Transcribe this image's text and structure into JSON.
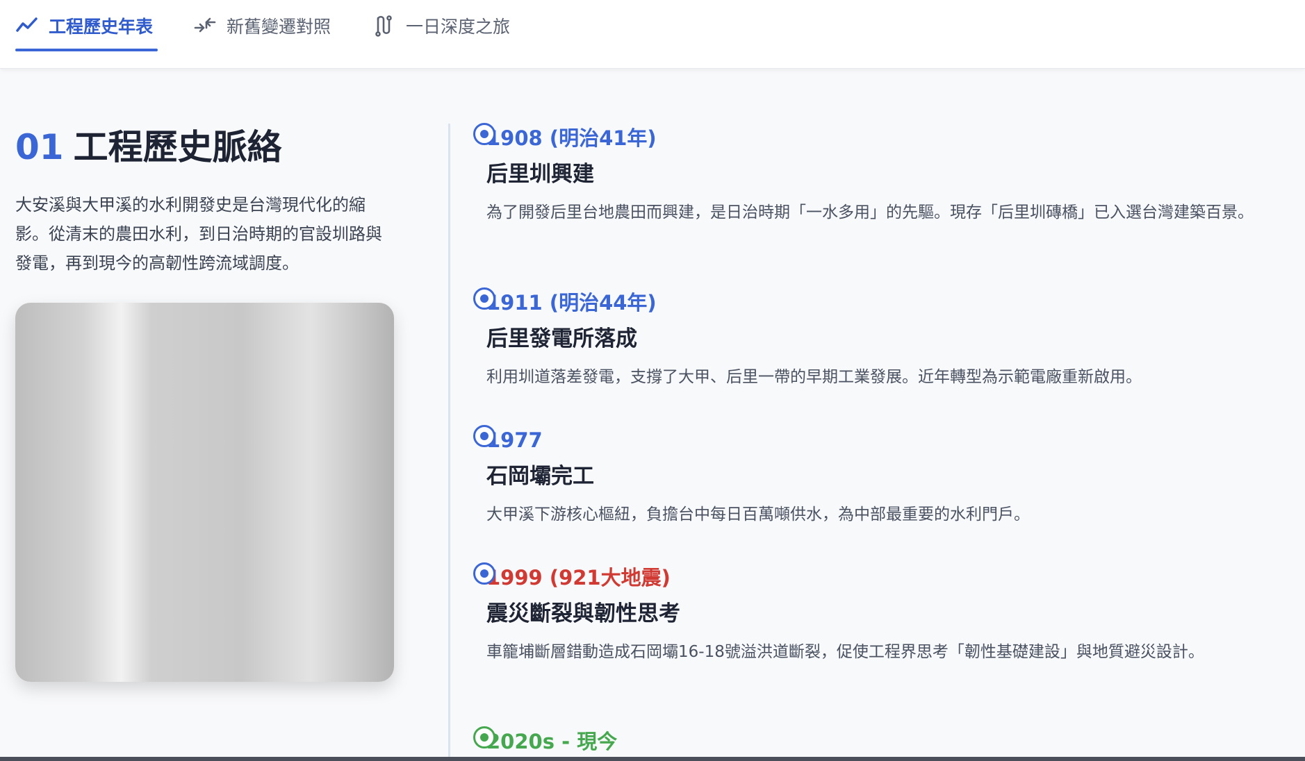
{
  "tabs": [
    {
      "label": "工程歷史年表",
      "icon": "trend-line-icon",
      "active": true
    },
    {
      "label": "新舊變遷對照",
      "icon": "compare-arrows-icon",
      "active": false
    },
    {
      "label": "一日深度之旅",
      "icon": "route-icon",
      "active": false
    }
  ],
  "section": {
    "number": "01",
    "title": "工程歷史脈絡",
    "intro": "大安溪與大甲溪的水利開發史是台灣現代化的縮影。從清末的農田水利，到日治時期的官設圳路與發電，再到現今的高韌性跨流域調度。"
  },
  "timeline": [
    {
      "year": "1908 (明治41年)",
      "title": "后里圳興建",
      "desc": "為了開發后里台地農田而興建，是日治時期「一水多用」的先驅。現存「后里圳磚橋」已入選台灣建築百景。",
      "color": "#3a66d6"
    },
    {
      "year": "1911 (明治44年)",
      "title": "后里發電所落成",
      "desc": "利用圳道落差發電，支撐了大甲、后里一帶的早期工業發展。近年轉型為示範電廠重新啟用。",
      "color": "#3a66d6"
    },
    {
      "year": "1977",
      "title": "石岡壩完工",
      "desc": "大甲溪下游核心樞紐，負擔台中每日百萬噸供水，為中部最重要的水利門戶。",
      "color": "#3a66d6"
    },
    {
      "year": "1999 (921大地震)",
      "title": "震災斷裂與韌性思考",
      "desc": "車籠埔斷層錯動造成石岡壩16-18號溢洪道斷裂，促使工程界思考「韌性基礎建設」與地質避災設計。",
      "color": "#d03a33"
    },
    {
      "year": "2020s - 現今",
      "title": "",
      "desc": "",
      "color": "#45a84e"
    }
  ]
}
